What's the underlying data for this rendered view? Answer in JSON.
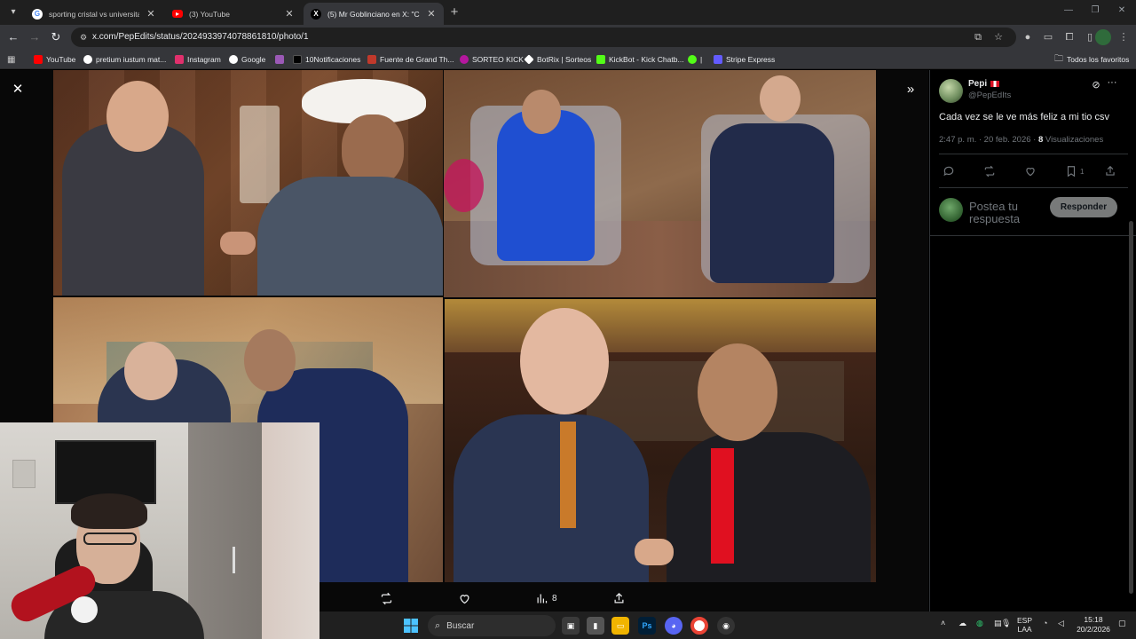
{
  "browser": {
    "tabs": [
      {
        "title": "sporting cristal vs universitario",
        "favicon": "google-favicon",
        "active": false
      },
      {
        "title": "(3) YouTube",
        "favicon": "youtube-favicon",
        "active": false
      },
      {
        "title": "(5) Mr Goblinciano en X: \"Com",
        "favicon": "x-favicon",
        "active": true
      }
    ],
    "new_tab": "+",
    "url": "x.com/PepEdits/status/2024933974078861810/photo/1",
    "bookmarks": [
      {
        "label": "YouTube",
        "color": "#ff0000"
      },
      {
        "label": "pretium iustum mat...",
        "color": "#ffffff"
      },
      {
        "label": "Instagram",
        "color": "#e1306c"
      },
      {
        "label": "Google",
        "color": "#ffffff"
      },
      {
        "label": "",
        "color": "#9b59b6"
      },
      {
        "label": "10Notificaciones",
        "color": "#e7e9ea"
      },
      {
        "label": "Fuente de Grand Th...",
        "color": "#c0392b"
      },
      {
        "label": "SORTEO KICK",
        "color": "#b5179e"
      },
      {
        "label": "BotRix | Sorteos",
        "color": "#f1c40f"
      },
      {
        "label": "KickBot - Kick Chatb...",
        "color": "#53fc18"
      },
      {
        "label": "|",
        "color": "#53fc18"
      },
      {
        "label": "Stripe Express",
        "color": "#635bff"
      }
    ],
    "all_favorites": "Todos los favoritos"
  },
  "viewer": {
    "actions": [
      {
        "name": "retweet",
        "count": ""
      },
      {
        "name": "like",
        "count": ""
      },
      {
        "name": "views",
        "count": "8"
      },
      {
        "name": "share",
        "count": ""
      }
    ]
  },
  "tweet": {
    "display_name": "Pepi",
    "handle": "@PepEdIts",
    "text": "Cada vez se le ve más feliz a mi tio csv",
    "time": "2:47 p. m. · 20 feb. 2026 ·",
    "views_count": "8",
    "views_label": "Visualizaciones",
    "bookmark_count": "1",
    "reply_placeholder": "Postea tu respuesta",
    "reply_button": "Responder"
  },
  "taskbar": {
    "search_label": "Buscar",
    "lang_top": "ESP",
    "lang_bottom": "LAA",
    "time": "15:18",
    "date": "20/2/2026"
  },
  "colors": {
    "x_background": "#000000",
    "chrome_dark": "#1f1f1f",
    "chrome_toolbar": "#35363a",
    "muted_text": "#71767b"
  }
}
